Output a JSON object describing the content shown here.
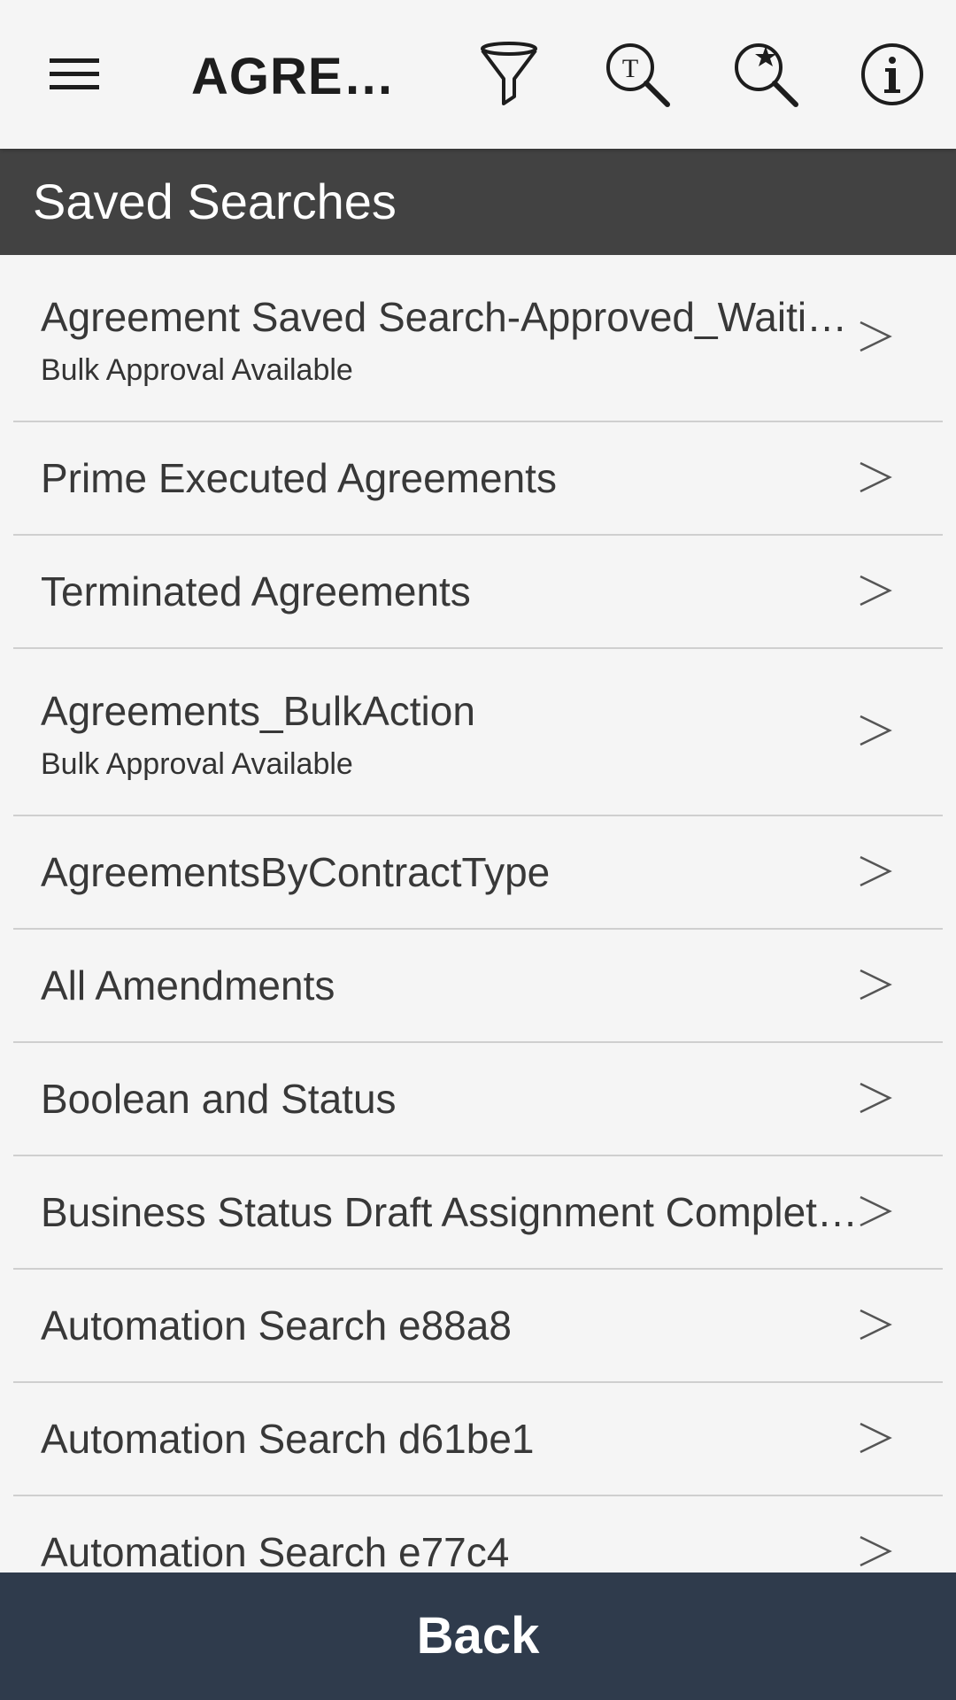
{
  "header": {
    "title": "AGREEMENTS",
    "icons": [
      "menu-icon",
      "filter-icon",
      "text-search-icon",
      "saved-search-icon",
      "info-icon"
    ]
  },
  "section": {
    "title": "Saved Searches"
  },
  "list": {
    "items": [
      {
        "title": "Agreement Saved Search-Approved_Waiting for Approval",
        "subtitle": "Bulk Approval Available"
      },
      {
        "title": "Prime Executed Agreements",
        "subtitle": ""
      },
      {
        "title": "Terminated Agreements",
        "subtitle": ""
      },
      {
        "title": "Agreements_BulkAction",
        "subtitle": "Bulk Approval Available"
      },
      {
        "title": "AgreementsByContractType",
        "subtitle": ""
      },
      {
        "title": "All Amendments",
        "subtitle": ""
      },
      {
        "title": "Boolean and Status",
        "subtitle": ""
      },
      {
        "title": "Business Status Draft Assignment Completed",
        "subtitle": ""
      },
      {
        "title": "Automation Search e88a8",
        "subtitle": ""
      },
      {
        "title": "Automation Search d61be1",
        "subtitle": ""
      },
      {
        "title": "Automation Search e77c4",
        "subtitle": ""
      }
    ],
    "chevron_glyph": ">"
  },
  "footer": {
    "back_label": "Back"
  },
  "colors": {
    "section_header_bg": "#424242",
    "bottom_bar_bg": "#2f3b4c",
    "background": "#f5f5f5"
  }
}
